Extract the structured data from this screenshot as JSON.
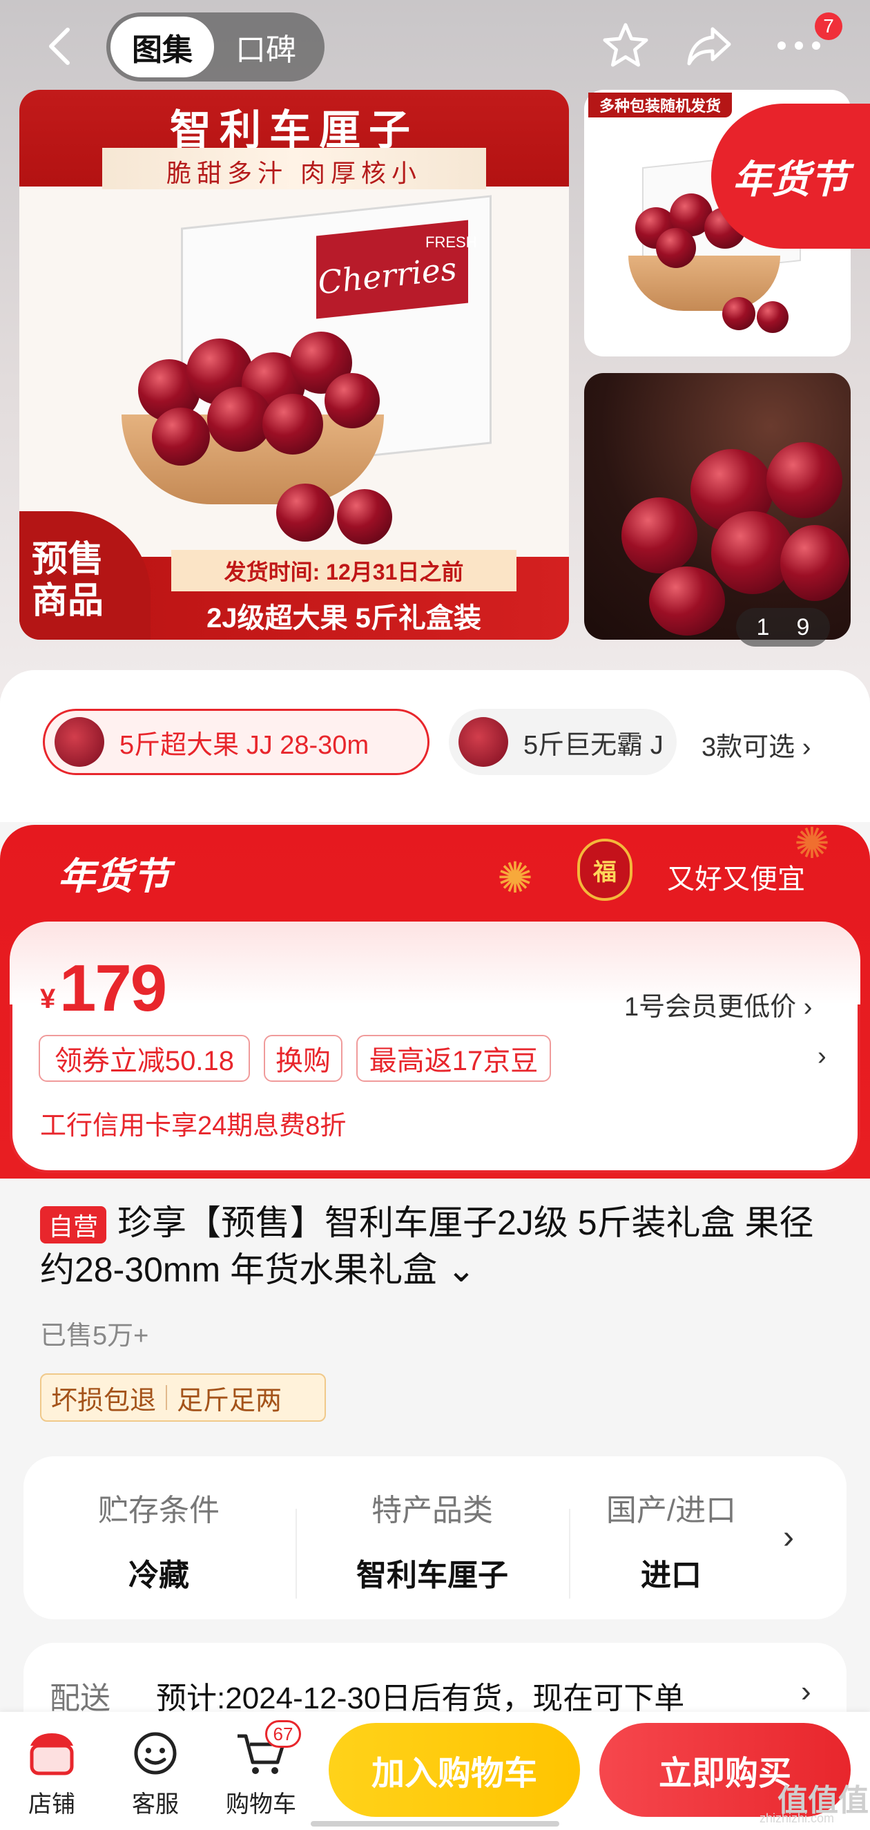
{
  "header": {
    "tabs": [
      {
        "label": "图集",
        "active": true
      },
      {
        "label": "口碑",
        "active": false
      }
    ],
    "more_badge": "7",
    "icons": [
      "back-icon",
      "star-icon",
      "share-icon",
      "more-icon"
    ]
  },
  "gallery": {
    "banner_title": "智利车厘子",
    "banner_subtitle": "脆甜多汁 肉厚核小",
    "box_brand": "Cherries",
    "box_small": "FRESH",
    "presale_line1": "预售",
    "presale_line2": "商品",
    "ship_time": "发货时间: 12月31日之前",
    "gift_line": "2J级超大果 5斤礼盒装",
    "thumb_tag": "多种包装随机发货",
    "festival_ribbon": "年货节",
    "counter_current": "1",
    "counter_total": "9"
  },
  "variants": {
    "selected": "5斤超大果 JJ 28-30m",
    "other": "5斤巨无霸 J",
    "more_label": "3款可选 ›"
  },
  "promo": {
    "festival_logo": "年货节",
    "lantern_char": "福",
    "slogan": "又好又便宜",
    "currency": "¥",
    "price": "179",
    "member_price": "1号会员更低价 ›",
    "tags": [
      "领券立减50.18",
      "换购",
      "最高返17京豆"
    ],
    "bank_offer": "工行信用卡享24期息费8折",
    "accent_color": "#e8262c"
  },
  "product": {
    "self_badge": "自营",
    "title": "珍享【预售】智利车厘子2J级 5斤装礼盒 果径约28-30mm 年货水果礼盒 ⌄",
    "sold": "已售5万+",
    "services": [
      "坏损包退",
      "足斤足两"
    ]
  },
  "attributes": [
    {
      "label": "贮存条件",
      "value": "冷藏"
    },
    {
      "label": "特产品类",
      "value": "智利车厘子"
    },
    {
      "label": "国产/进口",
      "value": "进口"
    }
  ],
  "delivery": {
    "label": "配送",
    "text": "预计:2024-12-30日后有货，现在可下单",
    "arrow": "›"
  },
  "bottom_bar": {
    "items": [
      {
        "label": "店铺",
        "icon": "store-icon"
      },
      {
        "label": "客服",
        "icon": "service-icon"
      },
      {
        "label": "购物车",
        "icon": "cart-icon"
      }
    ],
    "cart_badge": "67",
    "add_to_cart": "加入购物车",
    "buy_now": "立即购买"
  },
  "watermark": {
    "logo": "值值值",
    "site": "zhizhizhi.com"
  }
}
